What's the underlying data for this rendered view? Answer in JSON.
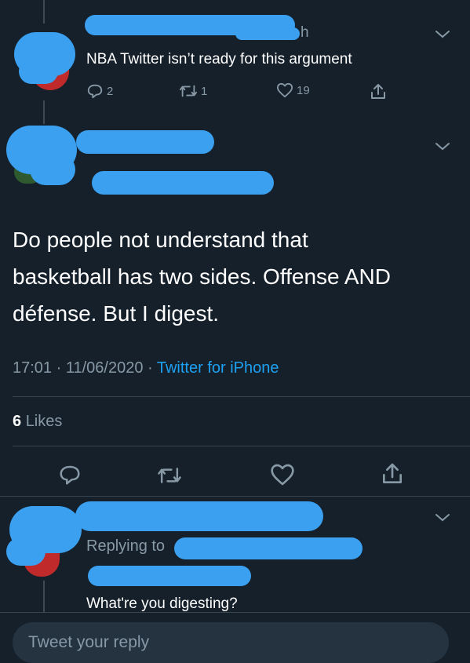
{
  "tweet1": {
    "handle_fragment": "h",
    "text": "NBA Twitter isn’t ready for this argument",
    "replies": "2",
    "retweets": "1",
    "likes": "19"
  },
  "main_tweet": {
    "text_line1": "Do people not understand that",
    "text_line2": "basketball has two sides. Offense AND",
    "text_line3": "défense. But I digest.",
    "timestamp": "17:01 · 11/06/2020 · ",
    "source": "Twitter for iPhone",
    "likes_count": "6",
    "likes_label": "Likes"
  },
  "reply_tweet": {
    "replying_to": "Replying to",
    "text": "What're you digesting?"
  },
  "composer": {
    "placeholder": "Tweet your reply"
  }
}
